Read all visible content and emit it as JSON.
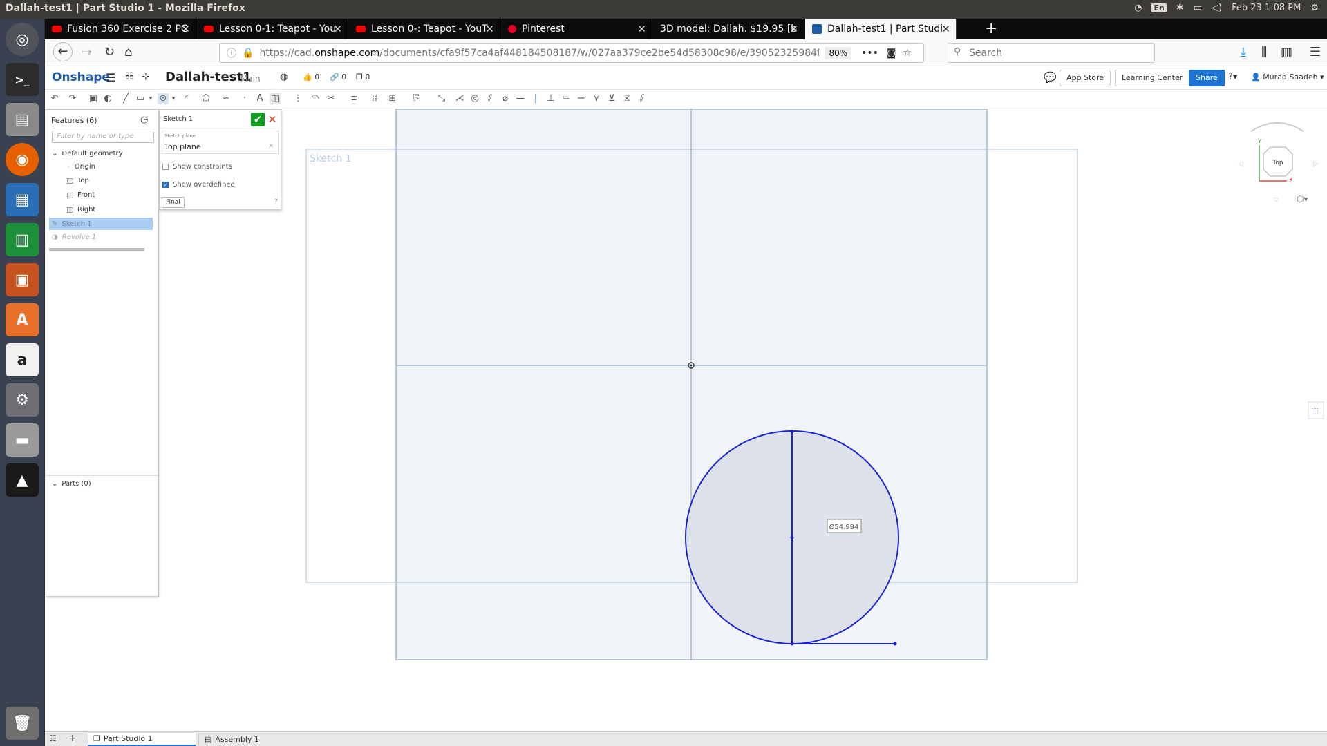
{
  "window_title": "Dallah-test1 | Part Studio 1 - Mozilla Firefox",
  "system_tray": {
    "keyboard": "En",
    "datetime": "Feb 23  1:08 PM"
  },
  "tabs": [
    {
      "label": "Fusion 360 Exercise 2 PC",
      "icon": "youtube-icon"
    },
    {
      "label": "Lesson 0-1: Teapot - You",
      "icon": "youtube-icon"
    },
    {
      "label": "Lesson 0-: Teapot - YouT",
      "icon": "youtube-icon"
    },
    {
      "label": "Pinterest",
      "icon": "pinterest-icon"
    },
    {
      "label": "3D model: Dallah. $19.95 [b",
      "icon": ""
    },
    {
      "label": "Dallah-test1 | Part Studi",
      "icon": "onshape-icon"
    }
  ],
  "url": {
    "prefix": "https://cad.",
    "domain": "onshape.com",
    "path": "/documents/cfa9f57ca4af448184508187/w/027aa379ce2be54d58308c98/e/39052325984f4d5c"
  },
  "zoom": "80%",
  "search_placeholder": "Search",
  "onshape": {
    "logo": "Onshape",
    "doc_name": "Dallah-test1",
    "branch": "Main",
    "likes": "0",
    "links": "0",
    "copies": "0",
    "app_store": "App Store",
    "learning_center": "Learning Center",
    "share": "Share",
    "user": "Murad Saadeh"
  },
  "features": {
    "title": "Features (6)",
    "filter_placeholder": "Filter by name or type",
    "default_geometry": "Default geometry",
    "items": [
      "Origin",
      "Top",
      "Front",
      "Right"
    ],
    "sketch": "Sketch 1",
    "revolve": "Revolve 1",
    "parts": "Parts (0)"
  },
  "dialog": {
    "title": "Sketch 1",
    "plane_label": "Sketch plane",
    "plane_value": "Top plane",
    "show_constraints": "Show constraints",
    "show_overdefined": "Show overdefined",
    "final": "Final"
  },
  "canvas": {
    "sketch_label": "Sketch 1",
    "dimension": "Ø54.994",
    "view_cube": "Top",
    "axis_y": "Y",
    "axis_x": "X"
  },
  "bottom_tabs": [
    "Part Studio 1",
    "Assembly 1"
  ]
}
